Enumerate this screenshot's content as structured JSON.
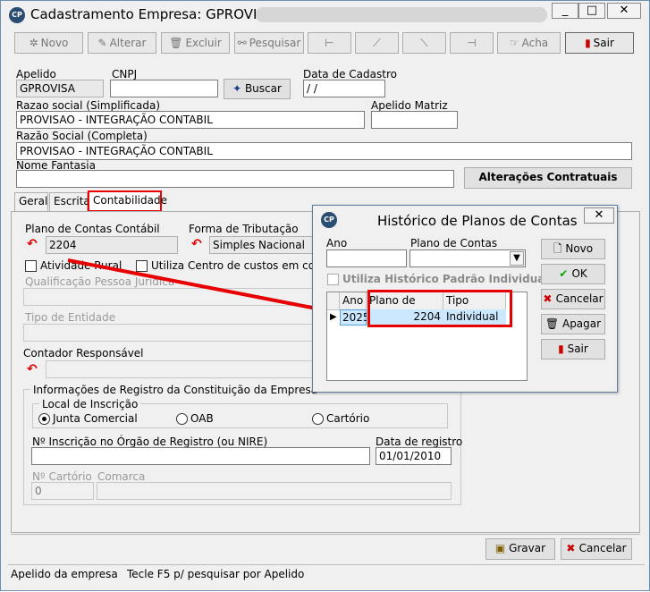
{
  "window": {
    "title": "Cadastramento Empresa: GPROVISA -",
    "logo_text": "CP",
    "min_label": "_",
    "max_label": "□",
    "close_label": "✕"
  },
  "toolbar": {
    "novo": "Novo",
    "alterar": "Alterar",
    "excluir": "Excluir",
    "pesquisar": "Pesquisar",
    "acha": "Acha",
    "sair": "Sair"
  },
  "header": {
    "apelido_label": "Apelido",
    "apelido_value": "GPROVISA",
    "cnpj_label": "CNPJ",
    "cnpj_value": "",
    "buscar_label": "Buscar",
    "data_cadastro_label": "Data de Cadastro",
    "data_cadastro_value": " / /",
    "razao_simpl_label": "Razao social (Simplificada)",
    "razao_simpl_value": "PROVISAO - INTEGRAÇÃO CONTABIL",
    "apelido_matriz_label": "Apelido Matriz",
    "apelido_matriz_value": "",
    "razao_compl_label": "Razão Social (Completa)",
    "razao_compl_value": "PROVISAO - INTEGRAÇÃO CONTABIL",
    "nome_fantasia_label": "Nome Fantasia",
    "nome_fantasia_value": "",
    "alteracoes_label": "Alterações Contratuais"
  },
  "tabs": [
    "Geral",
    "Escrita",
    "Contabilidade"
  ],
  "contabilidade": {
    "plano_label": "Plano de Contas Contábil",
    "plano_value": "2204",
    "forma_label": "Forma de Tributação",
    "forma_value": "Simples Nacional",
    "atividade_rural": "Atividade Rural",
    "centro_custos": "Utiliza Centro de custos em contas Pat",
    "qualificacao_label": "Qualificação Pessoa Jurídica",
    "tipo_entidade_label": "Tipo de Entidade",
    "contador_label": "Contador Responsável",
    "registro_group": "Informações de Registro da Constituição da Empresa",
    "local_group": "Local de Inscrição",
    "radio_junta": "Junta Comercial",
    "radio_oab": "OAB",
    "radio_cartorio": "Cartório",
    "nire_label": "Nº Inscrição no Órgão de Registro (ou NIRE)",
    "nire_value": "",
    "data_registro_label": "Data de registro",
    "data_registro_value": "01/01/2010",
    "n_cartorio_label": "Nº Cartório",
    "n_cartorio_value": "0",
    "comarca_label": "Comarca",
    "comarca_value": ""
  },
  "bottom": {
    "gravar": "Gravar",
    "cancelar": "Cancelar"
  },
  "status": {
    "left": "Apelido da empresa",
    "right": "Tecle F5 p/ pesquisar por Apelido"
  },
  "dialog": {
    "title": "Histórico de Planos de Contas",
    "close_label": "✕",
    "ano_label": "Ano",
    "plano_label": "Plano de Contas",
    "utiliza_label": "Utiliza Histórico Padrão Individual",
    "grid_headers": [
      "Ano",
      "Plano de Contas",
      "Tipo"
    ],
    "grid_rows": [
      {
        "ano": "2025",
        "plano": "2204",
        "tipo": "Individual"
      }
    ],
    "buttons": {
      "novo": "Novo",
      "ok": "OK",
      "cancelar": "Cancelar",
      "apagar": "Apagar",
      "sair": "Sair"
    }
  },
  "colors": {
    "highlight_red": "#e80000",
    "row_select": "#cce8ff"
  }
}
